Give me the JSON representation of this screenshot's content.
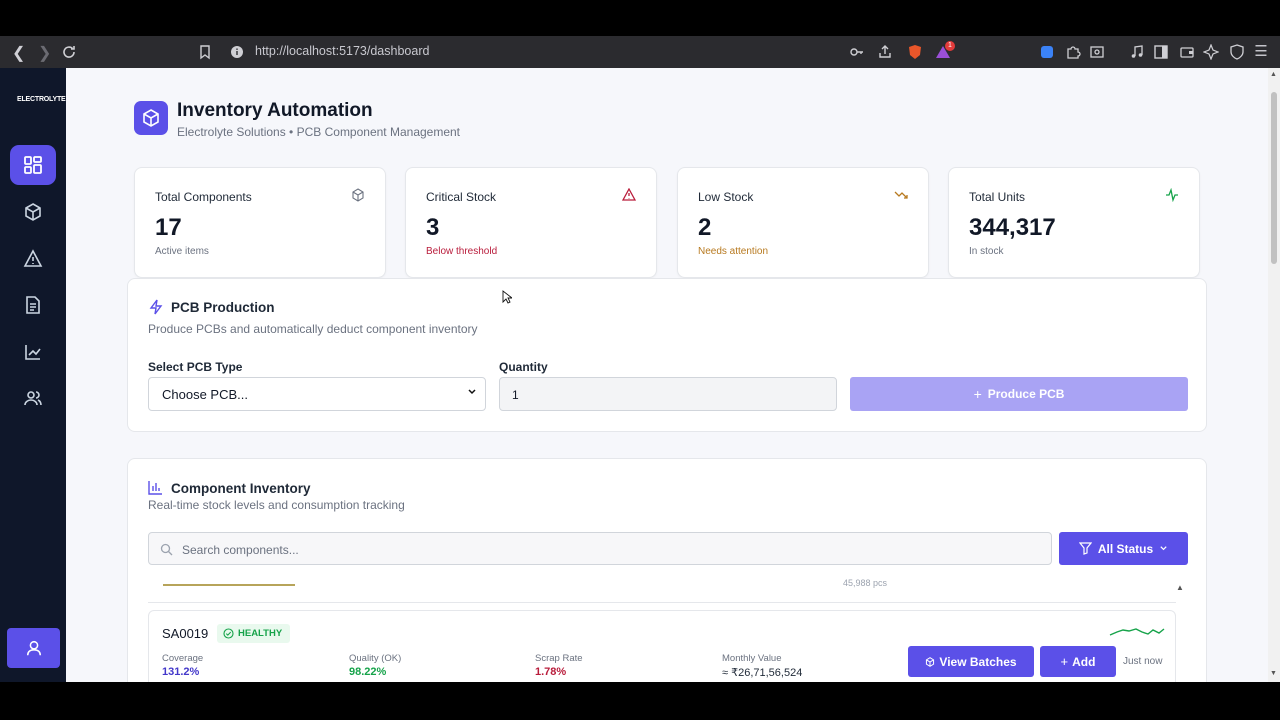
{
  "browser": {
    "url": "http://localhost:5173/dashboard",
    "notification_count": "1"
  },
  "sidebar": {
    "logo_text": "ELECTROLYTE",
    "items": [
      {
        "icon": "grid-icon",
        "active": true
      },
      {
        "icon": "box-icon",
        "active": false
      },
      {
        "icon": "warning-icon",
        "active": false
      },
      {
        "icon": "document-icon",
        "active": false
      },
      {
        "icon": "chart-line-icon",
        "active": false
      },
      {
        "icon": "users-icon",
        "active": false
      }
    ]
  },
  "header": {
    "title": "Inventory Automation",
    "subtitle": "Electrolyte Solutions • PCB Component Management"
  },
  "stats": [
    {
      "label": "Total Components",
      "value": "17",
      "sub": "Active items",
      "icon": "cube-icon",
      "color": "#6b7280"
    },
    {
      "label": "Critical Stock",
      "value": "3",
      "sub": "Below threshold",
      "icon": "alert-triangle-icon",
      "color": "#b91c3b"
    },
    {
      "label": "Low Stock",
      "value": "2",
      "sub": "Needs attention",
      "icon": "trending-down-icon",
      "color": "#b7791f"
    },
    {
      "label": "Total Units",
      "value": "344,317",
      "sub": "In stock",
      "icon": "activity-icon",
      "color": "#16a34a"
    }
  ],
  "production": {
    "title": "PCB Production",
    "description": "Produce PCBs and automatically deduct component inventory",
    "select_label": "Select PCB Type",
    "select_value": "Choose PCB...",
    "quantity_label": "Quantity",
    "quantity_value": "1",
    "button_label": "Produce PCB"
  },
  "inventory": {
    "title": "Component Inventory",
    "description": "Real-time stock levels and consumption tracking",
    "search_placeholder": "Search components...",
    "filter_label": "All Status",
    "prev_row_qty": "45,988 pcs",
    "row": {
      "code": "SA0019",
      "status": "HEALTHY",
      "metrics": [
        {
          "label": "Coverage",
          "value": "131.2%",
          "color": "#4338ca"
        },
        {
          "label": "Quality (OK)",
          "value": "98.22%",
          "color": "#16a34a"
        },
        {
          "label": "Scrap Rate",
          "value": "1.78%",
          "color": "#b91c3b"
        },
        {
          "label": "Monthly Value",
          "value": "≈ ₹26,71,56,524",
          "color": "#1f2937"
        }
      ],
      "view_batches_label": "View Batches",
      "add_label": "Add",
      "updated": "Just now"
    }
  }
}
